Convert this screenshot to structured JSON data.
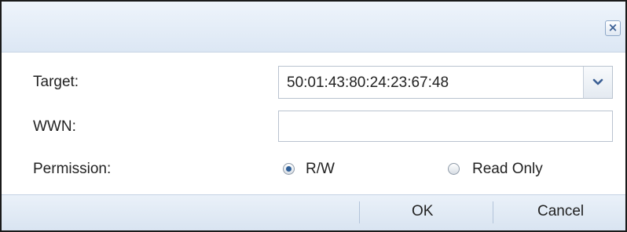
{
  "dialog": {
    "close_icon": "close-icon",
    "close_glyph": "×"
  },
  "form": {
    "target_label": "Target:",
    "target_value": "50:01:43:80:24:23:67:48",
    "wwn_label": "WWN:",
    "wwn_value": "",
    "permission_label": "Permission:",
    "permission_options": [
      {
        "label": "R/W",
        "selected": true
      },
      {
        "label": "Read Only",
        "selected": false
      }
    ]
  },
  "footer": {
    "ok_label": "OK",
    "cancel_label": "Cancel"
  },
  "colors": {
    "titlebar": "#dce7f4",
    "footer": "#d9e4f1",
    "accent": "#2f5f97"
  }
}
